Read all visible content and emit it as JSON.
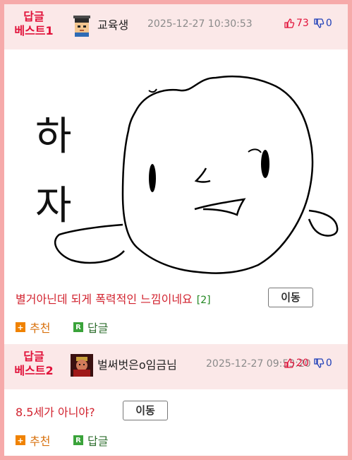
{
  "comments": [
    {
      "badge_line1": "답글",
      "badge_line2": "베스트1",
      "nickname": "교육생",
      "timestamp": "2025-12-27 10:30:53",
      "upvotes": "73",
      "downvotes": "0",
      "image_text": [
        "하",
        "자"
      ],
      "text": "별거아닌데 되게 폭력적인 느낌이네요",
      "reply_count": "[2]",
      "move_label": "이동",
      "recommend_label": "추천",
      "reply_label": "답글"
    },
    {
      "badge_line1": "답글",
      "badge_line2": "베스트2",
      "nickname": "벌써벗은o임금님",
      "timestamp": "2025-12-27 09:53:20",
      "upvotes": "20",
      "downvotes": "0",
      "text": "8.5세가 아니야?",
      "move_label": "이동",
      "recommend_label": "추천",
      "reply_label": "답글"
    }
  ],
  "colors": {
    "border": "#f6aaaa",
    "header_bg": "#fbe8e8",
    "badge": "#e1123a",
    "upvote": "#e1123a",
    "downvote": "#1f3fb8",
    "recommend_icon": "#f08200",
    "reply_icon": "#3aa33a"
  },
  "icons": {
    "plus": "+",
    "reply": "R",
    "thumb_up": "thumbs-up-icon",
    "thumb_down": "thumbs-down-icon"
  }
}
